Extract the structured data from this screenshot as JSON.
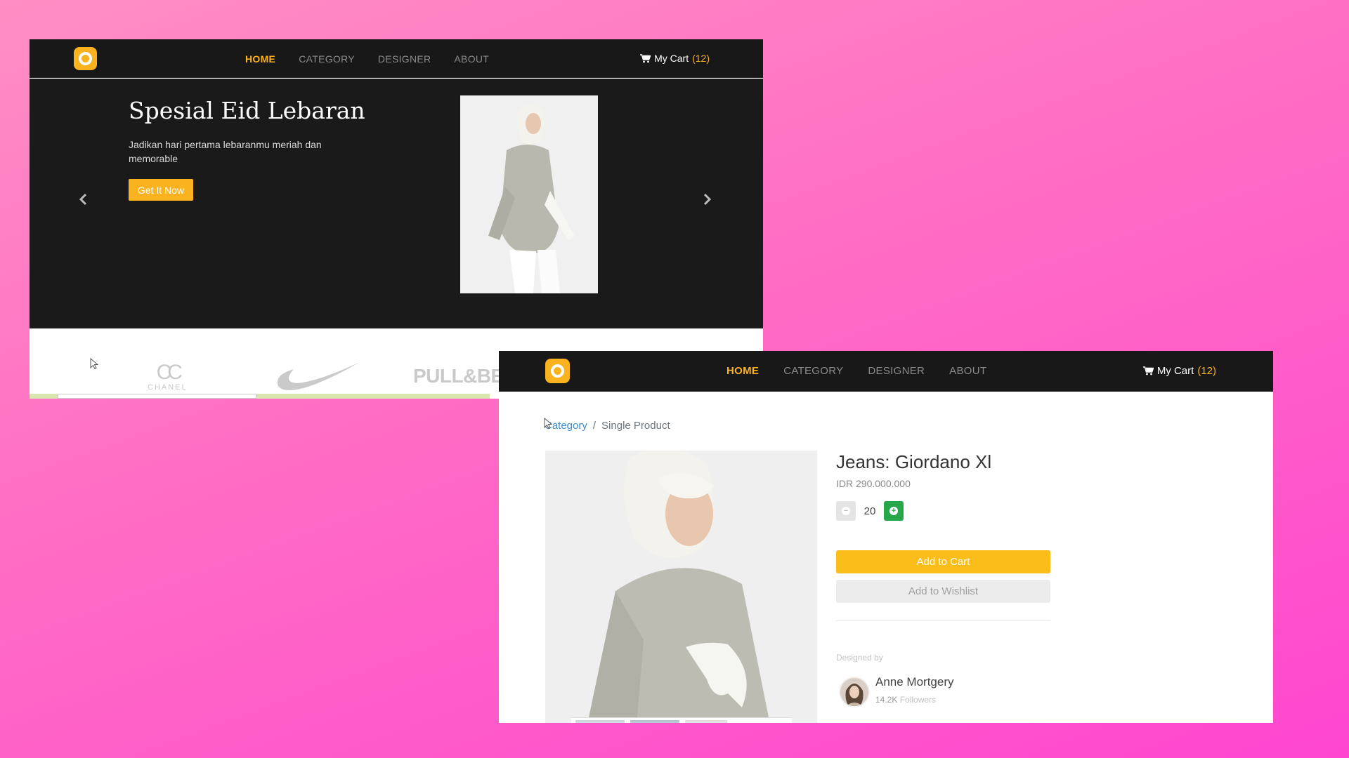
{
  "win1": {
    "nav": {
      "links": [
        "HOME",
        "CATEGORY",
        "DESIGNER",
        "ABOUT"
      ],
      "cart_label": "My Cart",
      "cart_count": "(12)"
    },
    "hero": {
      "title": "Spesial Eid Lebaran",
      "subtitle": "Jadikan hari pertama lebaranmu meriah dan memorable",
      "button": "Get It Now"
    },
    "brands": {
      "chanel": "CHANEL",
      "pull": "PULL&BE"
    }
  },
  "win2": {
    "nav": {
      "links": [
        "HOME",
        "CATEGORY",
        "DESIGNER",
        "ABOUT"
      ],
      "cart_label": "My Cart",
      "cart_count": "(12)"
    },
    "breadcrumb": {
      "category": "Category",
      "separator": "/",
      "current": "Single Product"
    },
    "product": {
      "title": "Jeans: Giordano Xl",
      "price": "IDR 290.000.000",
      "quantity": "20",
      "add_to_cart": "Add to Cart",
      "add_to_wishlist": "Add to Wishlist"
    },
    "designer": {
      "label": "Designed by",
      "name": "Anne Mortgery",
      "followers_count": "14.2K",
      "followers_label": "Followers"
    }
  },
  "colors": {
    "accent": "#fbb21f",
    "nav_bg": "#181818",
    "plus_green": "#27a74a",
    "link_blue": "#3b8ed4"
  },
  "icons": [
    "logo-icon",
    "cart-icon",
    "chevron-left-icon",
    "chevron-right-icon",
    "minus-icon",
    "plus-icon",
    "mouse-cursor-icon"
  ]
}
